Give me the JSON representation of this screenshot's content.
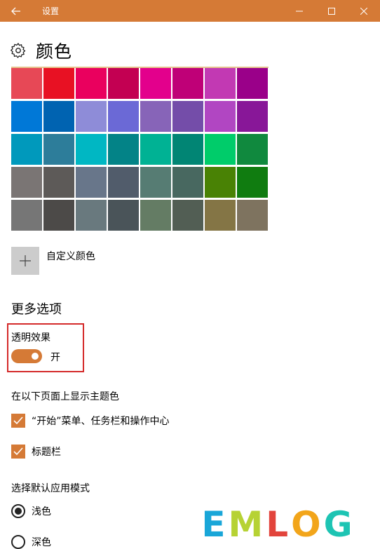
{
  "window": {
    "title": "设置",
    "accent": "#d57a36"
  },
  "page": {
    "title": "颜色"
  },
  "swatches": [
    [
      "#e74856",
      "#e81123",
      "#ea005e",
      "#c30052",
      "#e3008c",
      "#bf0077",
      "#c239b3",
      "#9a0089"
    ],
    [
      "#0078d7",
      "#0063b1",
      "#8e8cd8",
      "#6b69d6",
      "#8764b8",
      "#744da9",
      "#b146c2",
      "#881798"
    ],
    [
      "#0099bc",
      "#2d7d9a",
      "#00b7c3",
      "#038387",
      "#00b294",
      "#018574",
      "#00cc6a",
      "#10893e"
    ],
    [
      "#7a7574",
      "#5d5a58",
      "#68768a",
      "#515c6b",
      "#567c73",
      "#486860",
      "#498205",
      "#107c10"
    ],
    [
      "#767676",
      "#4c4a48",
      "#69797e",
      "#4a5459",
      "#647c64",
      "#525e54",
      "#847545",
      "#7e735f"
    ]
  ],
  "custom_color": {
    "label": "自定义颜色"
  },
  "more_options": {
    "title": "更多选项",
    "transparency": {
      "label": "透明效果",
      "state": "开",
      "on": true
    },
    "accent_surfaces": {
      "heading": "在以下页面上显示主题色",
      "items": [
        {
          "label": "“开始”菜单、任务栏和操作中心",
          "checked": true
        },
        {
          "label": "标题栏",
          "checked": true
        }
      ]
    },
    "app_mode": {
      "heading": "选择默认应用模式",
      "options": [
        {
          "label": "浅色",
          "selected": true
        },
        {
          "label": "深色",
          "selected": false
        }
      ]
    }
  },
  "watermark": {
    "letters": [
      {
        "char": "E",
        "color": "#19a6d8"
      },
      {
        "char": "M",
        "color": "#b6d234"
      },
      {
        "char": "L",
        "color": "#e2443c"
      },
      {
        "char": "O",
        "color": "#f2a51a"
      },
      {
        "char": "G",
        "color": "#1dc4b3"
      }
    ]
  }
}
